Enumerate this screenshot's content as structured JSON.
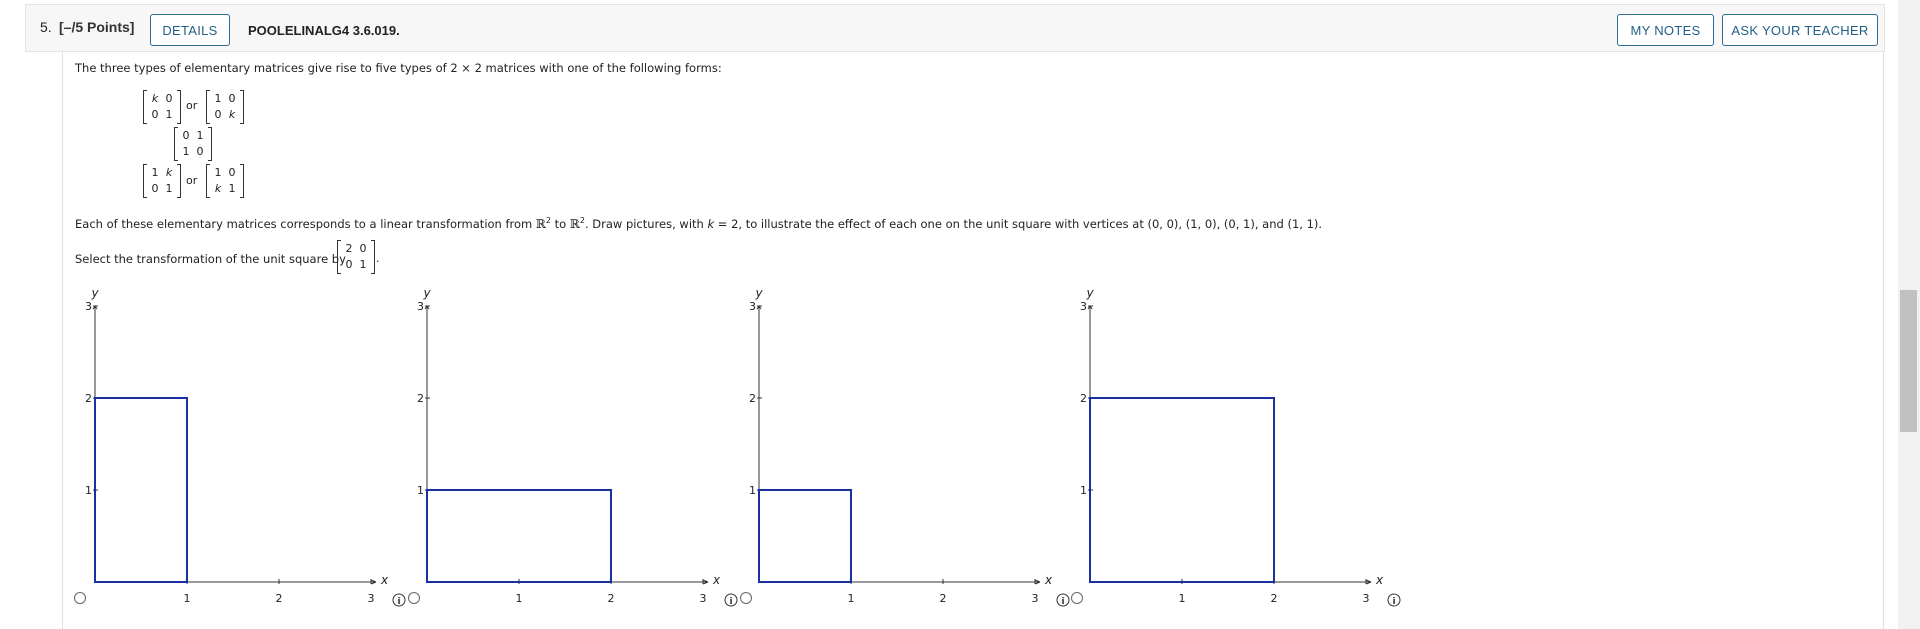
{
  "header": {
    "question_number": "5.",
    "points": "[–/5 Points]",
    "details_label": "DETAILS",
    "problem_code": "POOLELINALG4 3.6.019.",
    "my_notes_label": "MY NOTES",
    "ask_teacher_label": "ASK YOUR TEACHER"
  },
  "problem": {
    "intro": "The three types of elementary matrices give rise to five types of 2 × 2 matrices with one of the following forms:",
    "or_label": "or",
    "forms": {
      "row1": {
        "m1": [
          "k",
          "0",
          "0",
          "1"
        ],
        "m2": [
          "1",
          "0",
          "0",
          "k"
        ]
      },
      "row2": {
        "m1": [
          "0",
          "1",
          "1",
          "0"
        ]
      },
      "row3": {
        "m1": [
          "1",
          "k",
          "0",
          "1"
        ],
        "m2": [
          "1",
          "0",
          "k",
          "1"
        ]
      }
    },
    "sentence_a": "Each of these elementary matrices corresponds to a linear transformation from ",
    "r_symbol": "ℝ",
    "exp": "2",
    "sentence_b": " to ",
    "sentence_c": ". Draw pictures, with ",
    "k_var": "k",
    "sentence_d": " = 2, to illustrate the effect of each one on the unit square with vertices at (0, 0), (1, 0), (0, 1), and (1, 1).",
    "select_prompt": "Select the transformation of the unit square by",
    "select_matrix": [
      "2",
      "0",
      "0",
      "1"
    ]
  },
  "graphs": {
    "x_label": "x",
    "y_label": "y",
    "x_ticks": [
      "1",
      "2",
      "3"
    ],
    "y_ticks": [
      "1",
      "2",
      "3"
    ],
    "line_color": "#1a2fa0",
    "options": [
      {
        "rect": [
          0,
          0,
          1,
          2
        ]
      },
      {
        "rect": [
          0,
          0,
          2,
          1
        ]
      },
      {
        "rect": [
          0,
          0,
          1,
          1
        ]
      },
      {
        "rect": [
          0,
          0,
          2,
          2
        ]
      }
    ]
  },
  "icons": {
    "radio": "radio-button",
    "info": "info-icon"
  }
}
